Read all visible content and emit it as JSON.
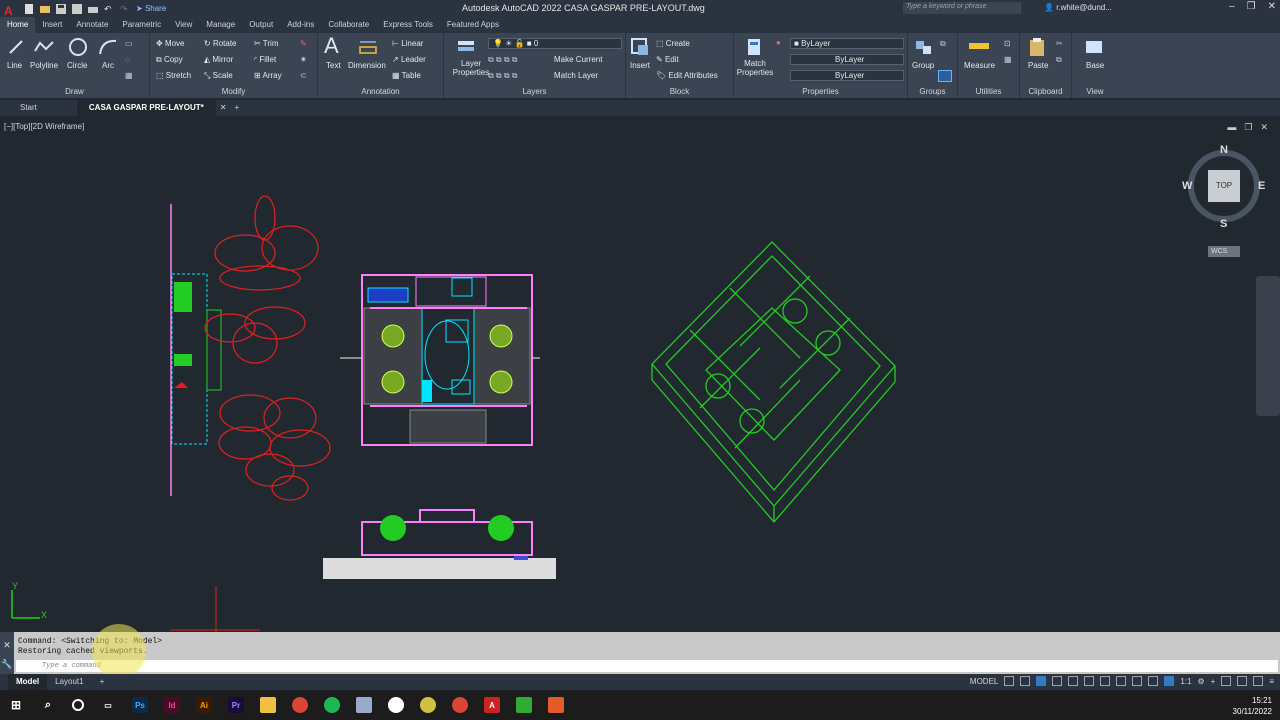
{
  "titlebar": {
    "share_label": "Share",
    "title": "Autodesk AutoCAD 2022    CASA GASPAR PRE-LAYOUT.dwg",
    "search_placeholder": "Type a keyword or phrase",
    "user": "r.white@dund..."
  },
  "ribbon_tabs": [
    "Home",
    "Insert",
    "Annotate",
    "Parametric",
    "View",
    "Manage",
    "Output",
    "Add-ins",
    "Collaborate",
    "Express Tools",
    "Featured Apps"
  ],
  "draw": {
    "line": "Line",
    "polyline": "Polyline",
    "circle": "Circle",
    "arc": "Arc",
    "title": "Draw"
  },
  "modify": {
    "move": "Move",
    "rotate": "Rotate",
    "trim": "Trim",
    "copy": "Copy",
    "mirror": "Mirror",
    "fillet": "Fillet",
    "stretch": "Stretch",
    "scale": "Scale",
    "array": "Array",
    "title": "Modify"
  },
  "annotation": {
    "text": "Text",
    "dimension": "Dimension",
    "linear": "Linear",
    "leader": "Leader",
    "table": "Table",
    "title": "Annotation"
  },
  "layers": {
    "layer_properties": "Layer Properties",
    "current_layer": "0",
    "make_current": "Make Current",
    "match_layer": "Match Layer",
    "title": "Layers"
  },
  "block": {
    "insert": "Insert",
    "create": "Create",
    "edit": "Edit",
    "edit_attributes": "Edit Attributes",
    "title": "Block"
  },
  "properties": {
    "match_properties": "Match Properties",
    "color": "ByLayer",
    "linetype": "ByLayer",
    "lineweight": "ByLayer",
    "title": "Properties"
  },
  "groups": {
    "group": "Group",
    "title": "Groups"
  },
  "utilities": {
    "measure": "Measure",
    "title": "Utilities"
  },
  "clipboard": {
    "paste": "Paste",
    "title": "Clipboard"
  },
  "view_panel": {
    "base": "Base",
    "title": "View"
  },
  "doc_tabs": {
    "start": "Start",
    "active": "CASA GASPAR PRE-LAYOUT*"
  },
  "viewport": {
    "label": "[−][Top][2D Wireframe]"
  },
  "viewcube": {
    "n": "N",
    "s": "S",
    "e": "E",
    "w": "W",
    "top": "TOP",
    "wcs": "WCS"
  },
  "ucs": {
    "x": "X",
    "y": "Y"
  },
  "command": {
    "line1": "Command:   <Switching to: Model>",
    "line2": "Restoring cached viewports.",
    "placeholder": "Type a command"
  },
  "layout_tabs": [
    "Model",
    "Layout1"
  ],
  "status": {
    "model": "MODEL",
    "scale": "1:1"
  },
  "clock": {
    "time": "15:21",
    "date": "30/11/2022"
  },
  "colors": {
    "tree": "#e02020",
    "wall": "#ff80ff",
    "axo": "#22cc22",
    "cyan": "#00e5ff"
  }
}
